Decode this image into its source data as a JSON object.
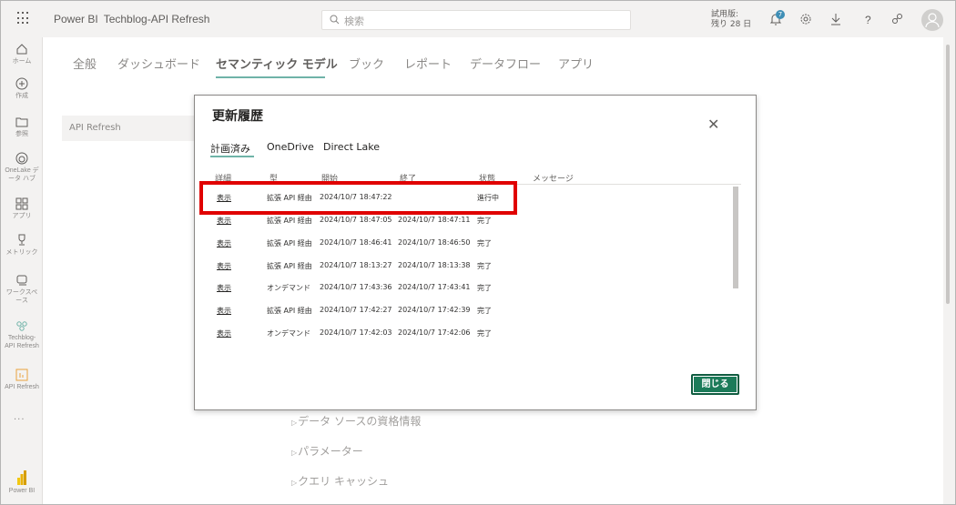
{
  "app": {
    "brand": "Power BI",
    "workspace": "Techblog-API Refresh",
    "search_placeholder": "検索",
    "trial_line1": "試用版:",
    "trial_line2": "残り 28 日",
    "notification_count": "7"
  },
  "leftnav": {
    "items": [
      {
        "label": "ホーム",
        "icon": "home-icon"
      },
      {
        "label": "作成",
        "icon": "create-icon"
      },
      {
        "label": "参照",
        "icon": "folder-icon"
      },
      {
        "label": "OneLake デ",
        "label2": "ータ ハブ",
        "icon": "onelake-icon"
      },
      {
        "label": "アプリ",
        "icon": "apps-icon"
      },
      {
        "label": "メトリック",
        "icon": "trophy-icon"
      },
      {
        "label": "ワークスペ",
        "label2": "ース",
        "icon": "workspaces-icon"
      },
      {
        "label": "Techblog-",
        "label2": "API Refresh",
        "icon": "workspace-icon"
      },
      {
        "label": "API Refresh",
        "icon": "report-icon"
      },
      {
        "label": "Power BI",
        "icon": "powerbi-logo-icon"
      }
    ],
    "more": "..."
  },
  "main": {
    "tabs": [
      "全般",
      "ダッシュボード",
      "セマンティック モデル",
      "ブック",
      "レポート",
      "データフロー",
      "アプリ"
    ],
    "active_tab": "セマンティック モデル",
    "left_item": "API Refresh",
    "sections": [
      "データ ソースの資格情報",
      "パラメーター",
      "クエリ キャッシュ"
    ]
  },
  "modal": {
    "title": "更新履歴",
    "tabs": [
      "計画済み",
      "OneDrive",
      "Direct Lake"
    ],
    "active_tab": "計画済み",
    "columns": [
      "詳細",
      "型",
      "開始",
      "終了",
      "状態",
      "メッセージ"
    ],
    "rows": [
      {
        "detail": "表示",
        "type": "拡張 API 経由",
        "start": "2024/10/7 18:47:22",
        "end": "",
        "status": "進行中"
      },
      {
        "detail": "表示",
        "type": "拡張 API 経由",
        "start": "2024/10/7 18:47:05",
        "end": "2024/10/7 18:47:11",
        "status": "完了"
      },
      {
        "detail": "表示",
        "type": "拡張 API 経由",
        "start": "2024/10/7 18:46:41",
        "end": "2024/10/7 18:46:50",
        "status": "完了"
      },
      {
        "detail": "表示",
        "type": "拡張 API 経由",
        "start": "2024/10/7 18:13:27",
        "end": "2024/10/7 18:13:38",
        "status": "完了"
      },
      {
        "detail": "表示",
        "type": "オンデマンド",
        "start": "2024/10/7 17:43:36",
        "end": "2024/10/7 17:43:41",
        "status": "完了"
      },
      {
        "detail": "表示",
        "type": "拡張 API 経由",
        "start": "2024/10/7 17:42:27",
        "end": "2024/10/7 17:42:39",
        "status": "完了"
      },
      {
        "detail": "表示",
        "type": "オンデマンド",
        "start": "2024/10/7 17:42:03",
        "end": "2024/10/7 17:42:06",
        "status": "完了"
      }
    ],
    "close_label": "閉じる"
  },
  "colors": {
    "accent_green": "#1c7b59",
    "tab_underline": "#6fb3a8",
    "highlight_red": "#e00000"
  }
}
